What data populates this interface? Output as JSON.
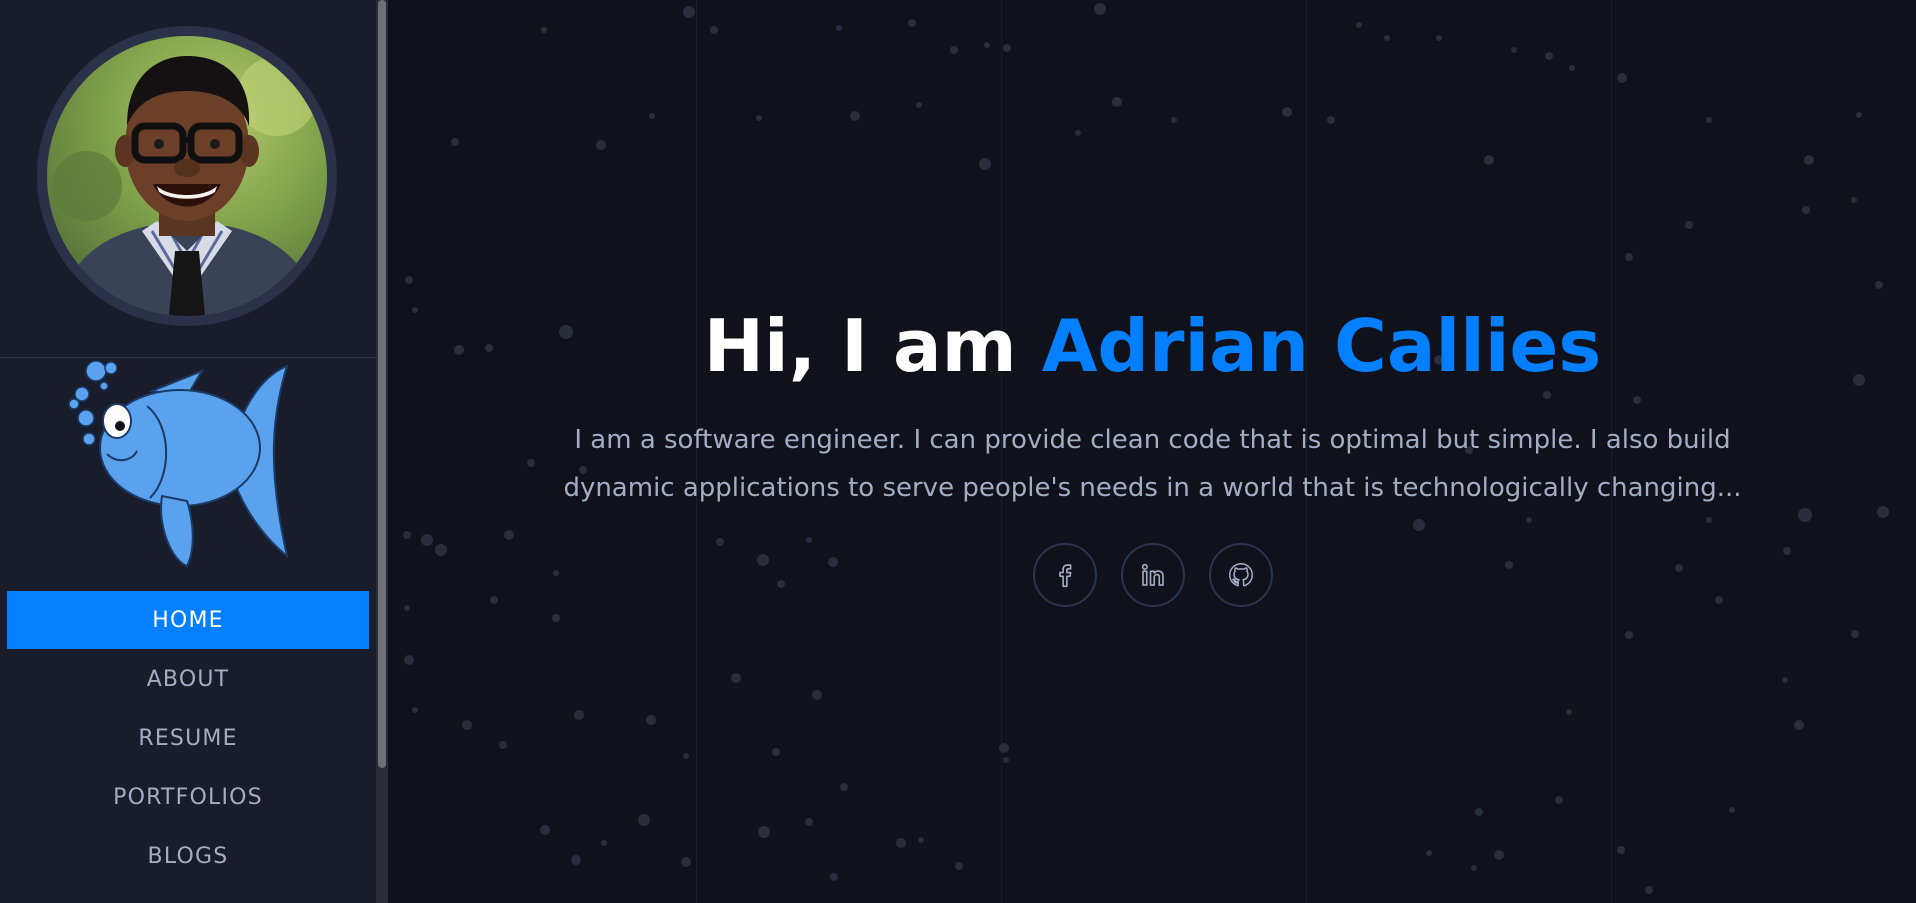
{
  "profile": {
    "avatar_alt": "Adrian Callies portrait",
    "mascot_alt": "Blue fish illustration"
  },
  "nav": {
    "items": [
      {
        "label": "HOME",
        "active": true
      },
      {
        "label": "ABOUT",
        "active": false
      },
      {
        "label": "RESUME",
        "active": false
      },
      {
        "label": "PORTFOLIOS",
        "active": false
      },
      {
        "label": "BLOGS",
        "active": false
      }
    ]
  },
  "hero": {
    "greeting": "Hi, I am ",
    "name": "Adrian Callies",
    "intro": "I am a software engineer. I can provide clean code that is optimal but simple. I also build dynamic applications to serve people's needs in a world that is technologically changing..."
  },
  "social": {
    "items": [
      {
        "name": "facebook",
        "icon": "facebook-icon"
      },
      {
        "name": "linkedin",
        "icon": "linkedin-icon"
      },
      {
        "name": "github",
        "icon": "github-icon"
      }
    ]
  },
  "colors": {
    "accent": "#037fff",
    "sidebar_bg": "#191d2b",
    "main_bg": "#10121b",
    "text_muted": "#a4acc4",
    "heading": "#ffffff"
  }
}
